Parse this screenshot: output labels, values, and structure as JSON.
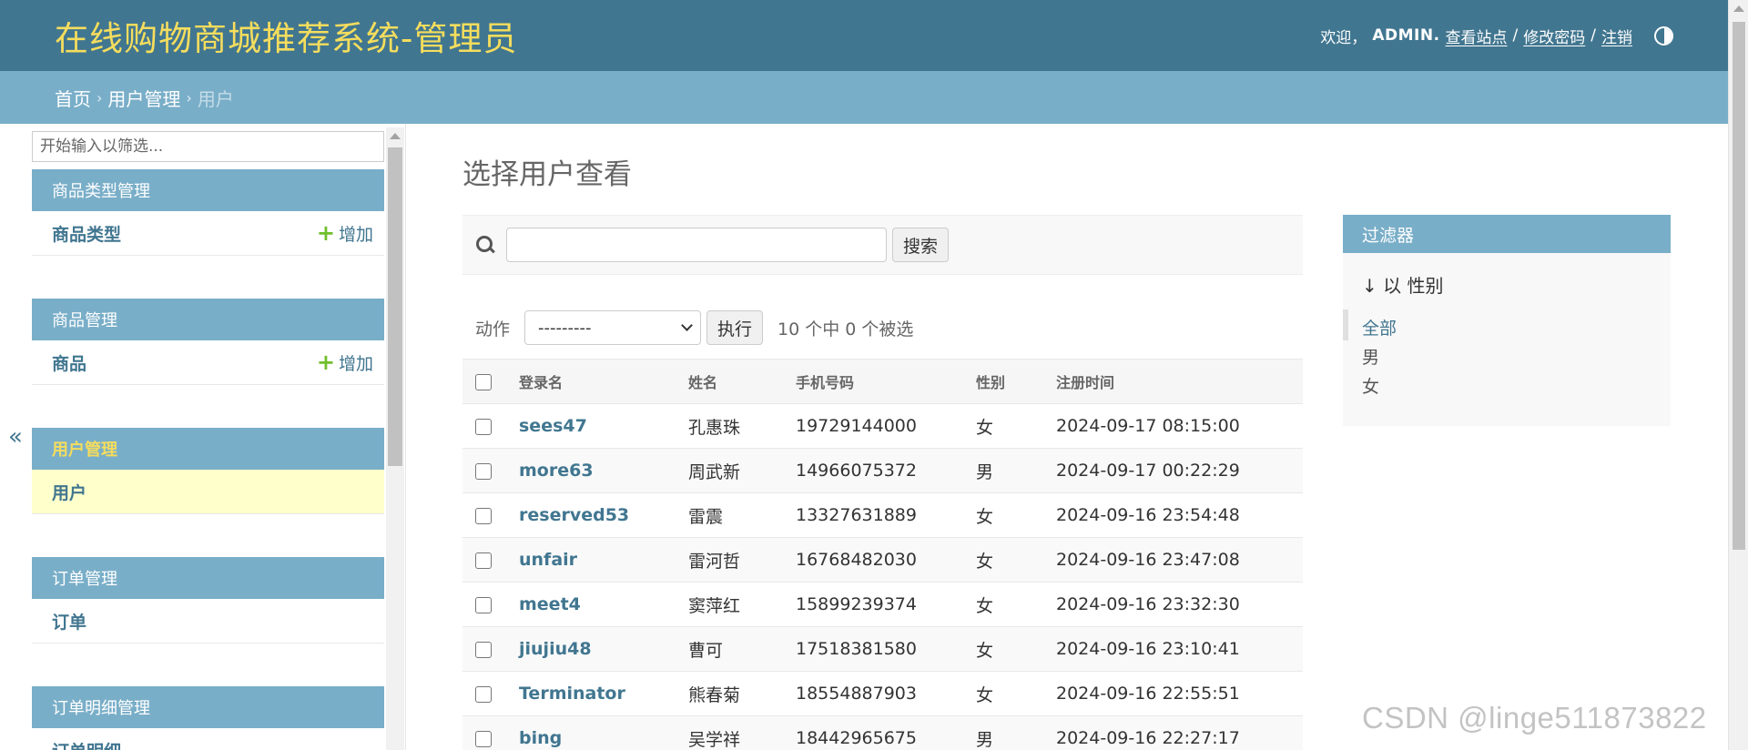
{
  "header": {
    "site_title": "在线购物商城推荐系统-管理员",
    "welcome": "欢迎，",
    "username": "ADMIN",
    "username_suffix": ".",
    "view_site": "查看站点",
    "sep": "/",
    "change_password": "修改密码",
    "logout": "注销"
  },
  "breadcrumbs": {
    "home": "首页",
    "app": "用户管理",
    "current": "用户",
    "sep": "›"
  },
  "sidebar": {
    "collapse_label": "«",
    "filter_placeholder": "开始输入以筛选...",
    "modules": [
      {
        "caption": "商品类型管理",
        "model": "商品类型",
        "add_label": "增加"
      },
      {
        "caption": "商品管理",
        "model": "商品",
        "add_label": "增加"
      },
      {
        "caption": "用户管理",
        "model": "用户"
      },
      {
        "caption": "订单管理",
        "model": "订单"
      },
      {
        "caption": "订单明细管理",
        "model": "订单明细"
      }
    ]
  },
  "content": {
    "title": "选择用户查看",
    "search_button": "搜索",
    "action_label": "动作",
    "action_selected": "---------",
    "run_button": "执行",
    "counter": "10 个中 0 个被选"
  },
  "table": {
    "columns": [
      "登录名",
      "姓名",
      "手机号码",
      "性别",
      "注册时间"
    ],
    "rows": [
      [
        "sees47",
        "孔惠珠",
        "19729144000",
        "女",
        "2024-09-17 08:15:00"
      ],
      [
        "more63",
        "周武新",
        "14966075372",
        "男",
        "2024-09-17 00:22:29"
      ],
      [
        "reserved53",
        "雷震",
        "13327631889",
        "女",
        "2024-09-16 23:54:48"
      ],
      [
        "unfair",
        "雷河哲",
        "16768482030",
        "女",
        "2024-09-16 23:47:08"
      ],
      [
        "meet4",
        "窦萍红",
        "15899239374",
        "女",
        "2024-09-16 23:32:30"
      ],
      [
        "jiujiu48",
        "曹可",
        "17518381580",
        "女",
        "2024-09-16 23:10:41"
      ],
      [
        "Terminator",
        "熊春菊",
        "18554887903",
        "女",
        "2024-09-16 22:55:51"
      ],
      [
        "bing",
        "吴学祥",
        "18442965675",
        "男",
        "2024-09-16 22:27:17"
      ]
    ]
  },
  "filter": {
    "caption": "过滤器",
    "by_label": "↓ 以 性别",
    "options": [
      "全部",
      "男",
      "女"
    ]
  },
  "watermark": "CSDN @linge511873822",
  "colors": {
    "header_bg": "#417690",
    "title_yellow": "#f5dd5d",
    "module_caption_bg": "#79aec8",
    "link": "#417690",
    "current_row_bg": "#ffffcc",
    "add_plus": "#70bf2b"
  }
}
